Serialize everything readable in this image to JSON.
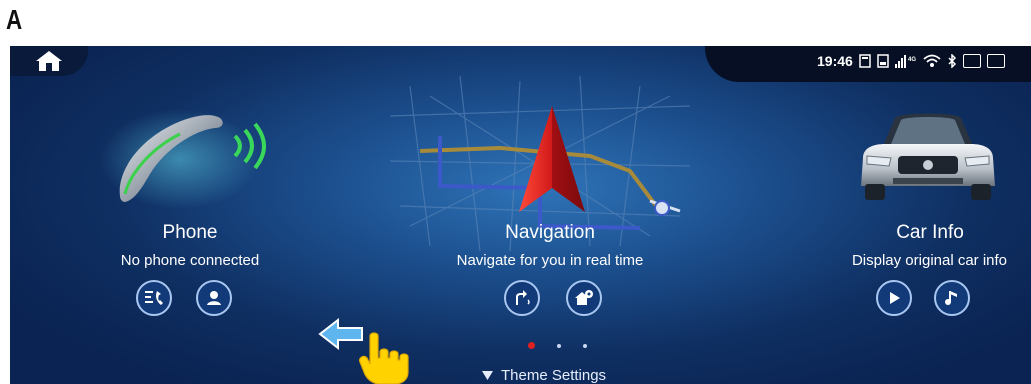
{
  "figure_label": "A",
  "status": {
    "time": "19:46"
  },
  "tiles": [
    {
      "title": "Phone",
      "subtitle": "No phone connected"
    },
    {
      "title": "Navigation",
      "subtitle": "Navigate for you in real time"
    },
    {
      "title": "Car Info",
      "subtitle": "Display original car info"
    }
  ],
  "theme_settings_label": "Theme Settings",
  "page_indicator": {
    "total": 3,
    "active": 1
  },
  "colors": {
    "accent_red": "#e02020",
    "background": "#1c4f8e"
  }
}
